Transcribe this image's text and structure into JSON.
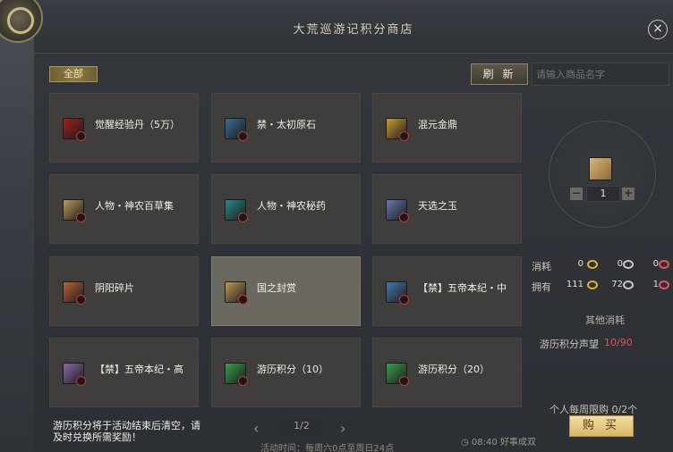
{
  "title": "大荒巡游记积分商店",
  "close_icon": "×",
  "tab_all": "全部",
  "refresh_label": "刷 新",
  "search_placeholder": "请输入商品名字",
  "items": [
    {
      "name": "觉醒经验丹（5万）",
      "icon": "pill-icon",
      "color": "#a32020"
    },
    {
      "name": "禁・太初原石",
      "icon": "stone-icon",
      "color": "#3c6c9a"
    },
    {
      "name": "混元金鼎",
      "icon": "cauldron-icon",
      "color": "#c8a030"
    },
    {
      "name": "人物・神农百草集",
      "icon": "book-icon",
      "color": "#b89a5a"
    },
    {
      "name": "人物・神农秘药",
      "icon": "potion-icon",
      "color": "#2a8a8a"
    },
    {
      "name": "天选之玉",
      "icon": "jade-icon",
      "color": "#6a78b0"
    },
    {
      "name": "阴阳碎片",
      "icon": "shard-icon",
      "color": "#b8643a"
    },
    {
      "name": "国之封赏",
      "icon": "scroll-icon",
      "color": "#c49a55"
    },
    {
      "name": "【禁】五帝本纪・中",
      "icon": "tome-icon",
      "color": "#4a7ab0"
    },
    {
      "name": "【禁】五帝本纪・高",
      "icon": "tome-icon",
      "color": "#8a6aa8"
    },
    {
      "name": "游历积分（10）",
      "icon": "gem-icon",
      "color": "#3aa04a"
    },
    {
      "name": "游历积分（20）",
      "icon": "gem-icon",
      "color": "#3aa04a"
    }
  ],
  "selected_index": 7,
  "quantity": "1",
  "consume_label": "消耗",
  "own_label": "拥有",
  "consume": {
    "gold": "0",
    "silver": "0",
    "red": "0"
  },
  "own": {
    "gold": "111",
    "silver": "72",
    "red": "1"
  },
  "other_cost_label": "其他消耗",
  "reputation_label": "游历积分声望",
  "reputation_value": "10/90",
  "weekly_limit_label": "个人每周限购",
  "weekly_limit_value": "0/2个",
  "buy_label": "购 买",
  "note": "游历积分将于活动结束后清空，请及时兑换所需奖励！",
  "page": "1/2",
  "activity_time": "活动时间：每周六0点至周日24点",
  "clock": "08:40",
  "clock_tag": "好事成双"
}
